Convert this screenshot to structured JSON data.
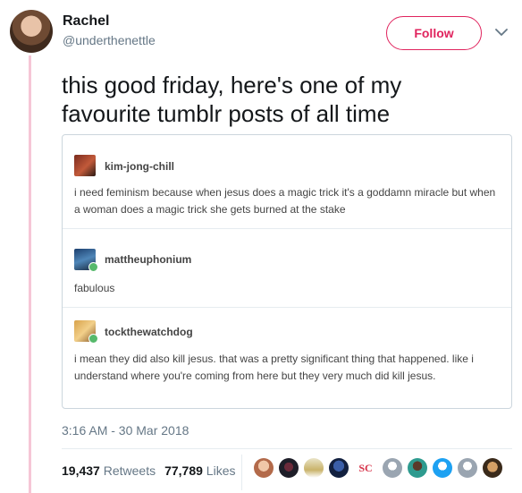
{
  "author": {
    "name": "Rachel",
    "handle": "@underthenettle"
  },
  "follow_label": "Follow",
  "tweet_text": "this good friday, here's one of my favourite tumblr posts of all time",
  "embedded_posts": [
    {
      "username": "kim-jong-chill",
      "body": "i need feminism because when jesus does a magic trick it's a goddamn miracle but when a woman does a magic trick she gets burned at the stake"
    },
    {
      "username": "mattheuphonium",
      "body": "fabulous"
    },
    {
      "username": "tockthewatchdog",
      "body": "i mean they did also kill jesus. that was a pretty significant thing that happened. like i understand where you're coming from here but they very much did kill jesus."
    }
  ],
  "timestamp": "3:16 AM - 30 Mar 2018",
  "stats": {
    "retweets_count": "19,437",
    "retweets_label": "Retweets",
    "likes_count": "77,789",
    "likes_label": "Likes"
  },
  "likers_sc_text": "SC",
  "colors": {
    "accent": "#e0245e",
    "thread_line": "#f6c6d6",
    "muted": "#657786"
  },
  "icons": {
    "caret": "chevron-down-icon"
  }
}
